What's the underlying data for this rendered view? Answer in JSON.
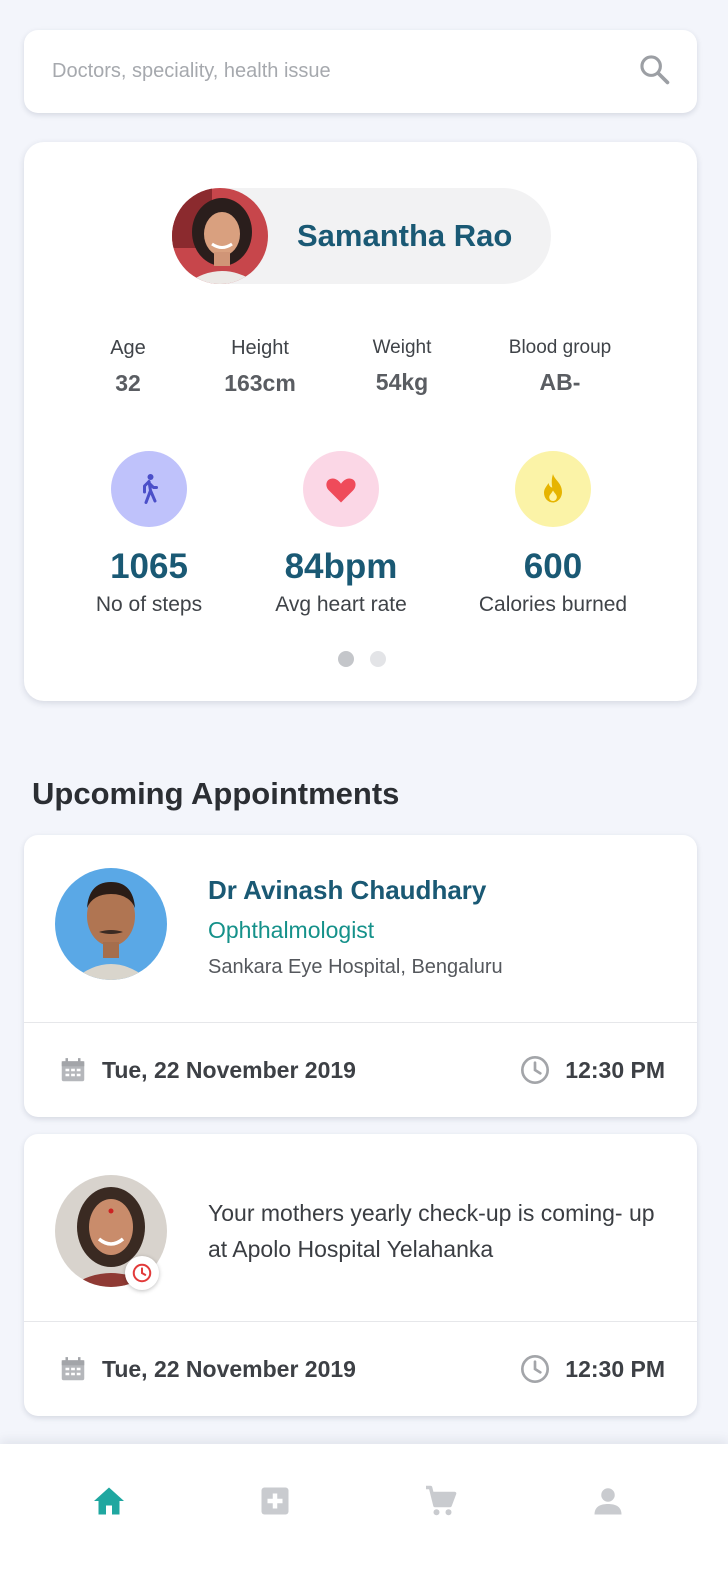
{
  "search": {
    "placeholder": "Doctors, speciality, health issue",
    "icon": "search-icon"
  },
  "profile": {
    "name": "Samantha Rao",
    "stats": [
      {
        "label": "Age",
        "value": "32"
      },
      {
        "label": "Height",
        "value": "163cm"
      },
      {
        "label": "Weight",
        "value": "54kg"
      },
      {
        "label": "Blood group",
        "value": "AB-"
      }
    ],
    "metrics": [
      {
        "value": "1065",
        "label": "No of steps",
        "icon": "walking-icon",
        "bg": "#bfc2fb",
        "color": "#4b4fc9"
      },
      {
        "value": "84bpm",
        "label": "Avg heart rate",
        "icon": "heart-icon",
        "bg": "#fbd7e6",
        "color": "#ef4b5a"
      },
      {
        "value": "600",
        "label": "Calories burned",
        "icon": "flame-icon",
        "bg": "#fbf3a7",
        "color": "#e6b400"
      }
    ],
    "carousel": {
      "pages": 2,
      "active": 1
    }
  },
  "upcoming": {
    "title": "Upcoming Appointments",
    "appointments": [
      {
        "doctor": "Dr Avinash Chaudhary",
        "speciality": "Ophthalmologist",
        "hospital": "Sankara Eye Hospital, Bengaluru",
        "date": "Tue, 22 November 2019",
        "time": "12:30 PM"
      },
      {
        "message": "Your mothers yearly check-up is coming- up at Apolo Hospital Yelahanka",
        "date": "Tue, 22 November 2019",
        "time": "12:30 PM"
      }
    ]
  },
  "colors": {
    "primary": "#1a5974",
    "teal": "#15918a",
    "nav_active": "#1fa7a0",
    "nav_inactive": "#c9cbcf"
  },
  "nav": {
    "items": [
      {
        "icon": "home-icon",
        "active": true
      },
      {
        "icon": "medical-plus-icon",
        "active": false
      },
      {
        "icon": "cart-icon",
        "active": false
      },
      {
        "icon": "person-icon",
        "active": false
      }
    ]
  }
}
